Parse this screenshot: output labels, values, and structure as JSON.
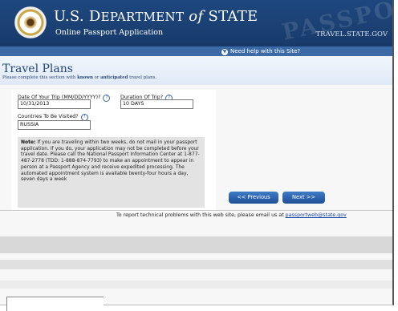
{
  "header": {
    "department_prefix": "U.S. D",
    "department_mid": "EPARTMENT",
    "department_of": " of ",
    "department_suffix": "STATE",
    "subtitle": "Online Passport Application",
    "watermark": "PASSPORT",
    "travel_link": "TRAVEL.STATE.GOV",
    "help_text": "Need help with this Site?"
  },
  "page": {
    "title": "Travel Plans",
    "instruction_prefix": "Please complete this section with ",
    "instruction_known": "known",
    "instruction_or": " or ",
    "instruction_anticipated": "anticipated",
    "instruction_suffix": " travel plans."
  },
  "form": {
    "date_label": "Date Of Your Trip (MM/DD/YYYY)?",
    "date_value": "10/31/2013",
    "duration_label": "Duration Of Trip?",
    "duration_value": "10 DAYS",
    "countries_label": "Countries To Be Visited?",
    "countries_value": "RUSSIA"
  },
  "note": {
    "heading": "Note:",
    "text": " If you are traveling within two weeks, do not mail in your passport application. If you do, your application may not be completed before your travel date. Please call the National Passport Information Center at 1-877-487-2778 (TDD: 1-888-874-7793) to make an appointment to appear in person at a Passport Agency and receive expedited processing. The automated appointment system is available twenty-four hours a day, seven days a week"
  },
  "buttons": {
    "previous": "<< Previous",
    "next": "Next >>"
  },
  "footer": {
    "text": "To report technical problems with this web site, please email us at ",
    "email": "passportweb@state.gov"
  }
}
